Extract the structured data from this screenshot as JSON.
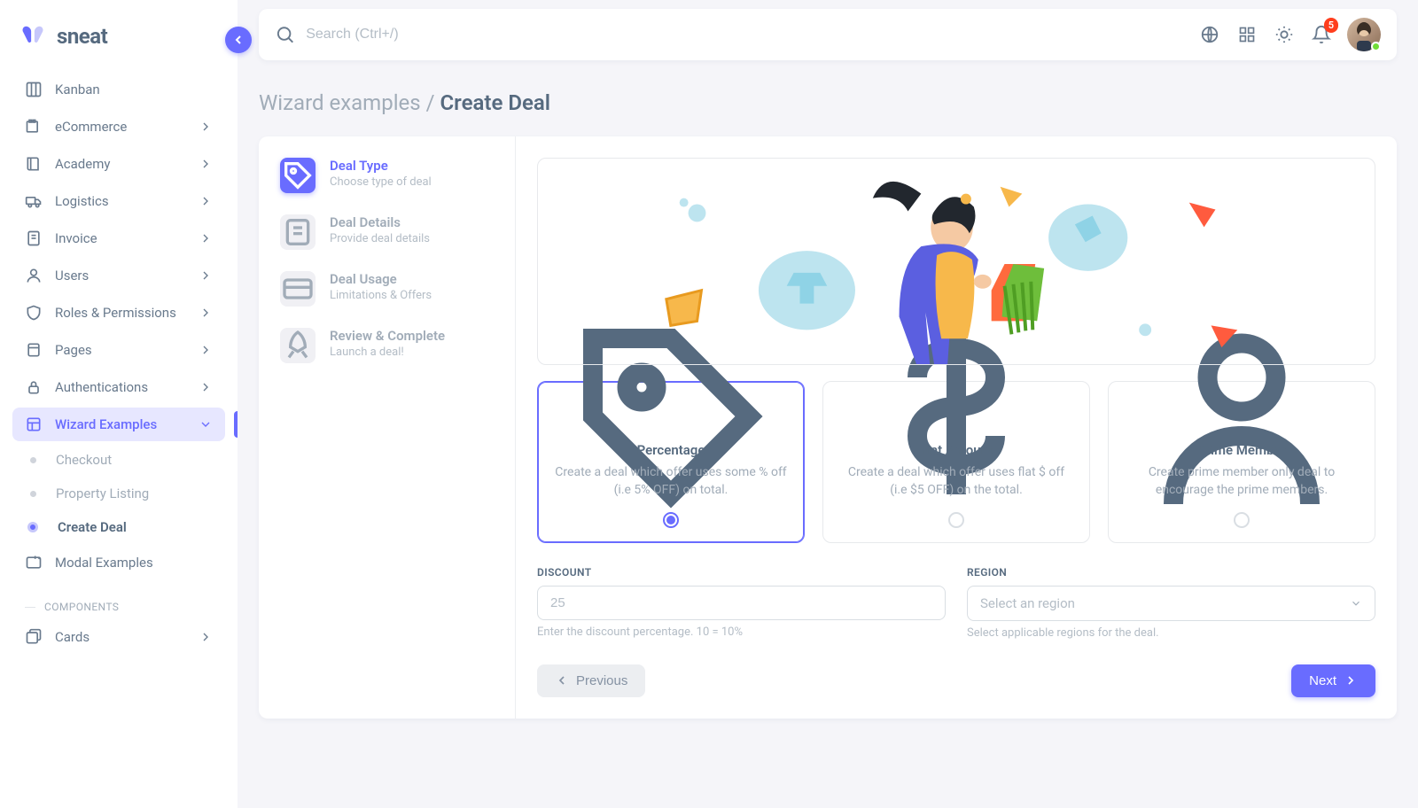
{
  "brand": {
    "name": "sneat"
  },
  "search": {
    "placeholder": "Search (Ctrl+/)"
  },
  "notifications": {
    "count": "5"
  },
  "sidebar": {
    "items": [
      {
        "label": "Kanban",
        "icon": "kanban"
      },
      {
        "label": "eCommerce",
        "icon": "cart",
        "expandable": true
      },
      {
        "label": "Academy",
        "icon": "book",
        "expandable": true
      },
      {
        "label": "Logistics",
        "icon": "truck",
        "expandable": true
      },
      {
        "label": "Invoice",
        "icon": "invoice",
        "expandable": true
      },
      {
        "label": "Users",
        "icon": "user",
        "expandable": true
      },
      {
        "label": "Roles & Permissions",
        "icon": "shield",
        "expandable": true
      },
      {
        "label": "Pages",
        "icon": "page",
        "expandable": true
      },
      {
        "label": "Authentications",
        "icon": "lock",
        "expandable": true
      },
      {
        "label": "Wizard Examples",
        "icon": "wizard",
        "expandable": true,
        "active": true
      },
      {
        "label": "Modal Examples",
        "icon": "modal"
      }
    ],
    "sub_items": [
      {
        "label": "Checkout"
      },
      {
        "label": "Property Listing"
      },
      {
        "label": "Create Deal",
        "current": true
      }
    ],
    "section": "COMPONENTS",
    "components_items": [
      {
        "label": "Cards",
        "icon": "cards",
        "expandable": true
      }
    ]
  },
  "breadcrumb": {
    "parent": "Wizard examples",
    "sep": "/",
    "current": "Create Deal"
  },
  "steps": [
    {
      "title": "Deal Type",
      "sub": "Choose type of deal",
      "icon": "tag",
      "active": true
    },
    {
      "title": "Deal Details",
      "sub": "Provide deal details",
      "icon": "details"
    },
    {
      "title": "Deal Usage",
      "sub": "Limitations & Offers",
      "icon": "card"
    },
    {
      "title": "Review & Complete",
      "sub": "Launch a deal!",
      "icon": "rocket"
    }
  ],
  "deal_types": [
    {
      "title": "Percentage",
      "desc": "Create a deal which offer uses some % off (i.e 5% OFF) on total.",
      "icon": "tag",
      "selected": true
    },
    {
      "title": "Flat Amount",
      "desc": "Create a deal which offer uses flat $ off (i.e $5 OFF) on the total.",
      "icon": "dollar"
    },
    {
      "title": "Prime Member",
      "desc": "Create prime member only deal to encourage the prime members.",
      "icon": "person"
    }
  ],
  "form": {
    "discount": {
      "label": "DISCOUNT",
      "placeholder": "25",
      "help": "Enter the discount percentage. 10 = 10%"
    },
    "region": {
      "label": "REGION",
      "placeholder": "Select an region",
      "help": "Select applicable regions for the deal."
    }
  },
  "buttons": {
    "prev": "Previous",
    "next": "Next"
  }
}
